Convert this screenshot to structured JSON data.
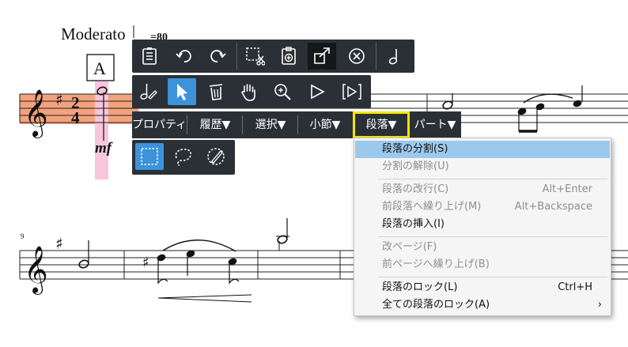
{
  "score": {
    "tempo_text": "Moderato",
    "tempo_value": "=80",
    "rehearsal_mark": "A",
    "time_signature_top": "2",
    "time_signature_bottom": "4",
    "dynamic": "mf",
    "measure_number": "9"
  },
  "toolbar_row1": [
    {
      "name": "properties-list-icon"
    },
    {
      "name": "undo-icon"
    },
    {
      "name": "redo-icon"
    },
    {
      "name": "cut-selection-icon"
    },
    {
      "name": "paste-clipboard-icon"
    },
    {
      "name": "export-box-icon"
    },
    {
      "name": "close-circle-icon"
    },
    {
      "name": "half-note-icon"
    }
  ],
  "toolbar_row2": [
    {
      "name": "note-pencil-icon"
    },
    {
      "name": "pointer-arrow-icon"
    },
    {
      "name": "trash-icon"
    },
    {
      "name": "hand-grab-icon"
    },
    {
      "name": "zoom-icon"
    },
    {
      "name": "play-icon"
    },
    {
      "name": "play-bracket-icon"
    }
  ],
  "toolbar_row3": [
    {
      "name": "rect-select-icon"
    },
    {
      "name": "lasso-select-icon"
    },
    {
      "name": "brush-select-icon"
    }
  ],
  "menu_bar": {
    "properties": "プロパティ",
    "history": "履歴▼",
    "select": "選択▼",
    "measure": "小節▼",
    "system": "段落▼",
    "part": "パート▼"
  },
  "dropdown": {
    "items": [
      {
        "label": "段落の分割(S)",
        "shortcut": ""
      },
      {
        "label": "分割の解除(U)",
        "shortcut": ""
      },
      {
        "label": "段落の改行(C)",
        "shortcut": "Alt+Enter"
      },
      {
        "label": "前段落へ繰り上げ(M)",
        "shortcut": "Alt+Backspace"
      },
      {
        "label": "段落の挿入(I)",
        "shortcut": ""
      },
      {
        "label": "改ページ(F)",
        "shortcut": ""
      },
      {
        "label": "前ページへ繰り上げ(B)",
        "shortcut": ""
      },
      {
        "label": "段落のロック(L)",
        "shortcut": "Ctrl+H"
      },
      {
        "label": "全ての段落のロック(A)",
        "shortcut": "",
        "submenu_arrow": "›"
      }
    ]
  },
  "colors": {
    "toolbar_bg": "#2b3036",
    "selected_button": "#3c93da",
    "menu_highlight": "#9cc8ec",
    "yellow_outline": "#f4e600",
    "staff_highlight": "#f3a27e",
    "note_highlight": "#f7c6dc"
  }
}
